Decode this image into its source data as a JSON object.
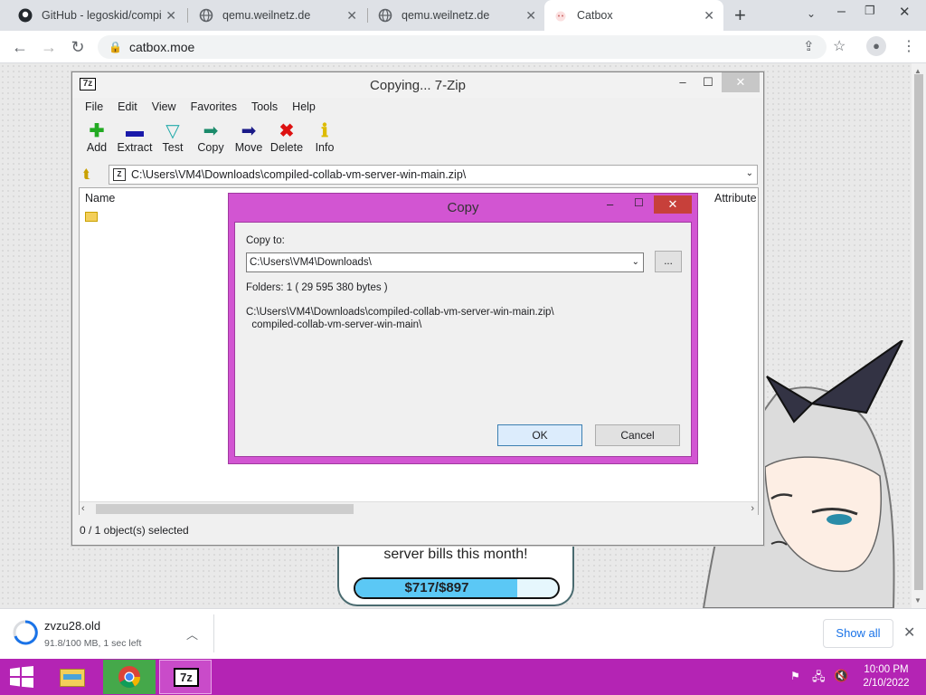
{
  "browser": {
    "tabs": [
      {
        "title": "GitHub - legoskid/compi"
      },
      {
        "title": "qemu.weilnetz.de"
      },
      {
        "title": "qemu.weilnetz.de"
      },
      {
        "title": "Catbox"
      }
    ],
    "url": "catbox.moe"
  },
  "page": {
    "donation_text": "server bills this month!",
    "donation_amount": "$717/$897",
    "donation_progress": 0.8
  },
  "zip": {
    "title": "Copying... 7-Zip",
    "logo": "7z",
    "menu": [
      "File",
      "Edit",
      "View",
      "Favorites",
      "Tools",
      "Help"
    ],
    "tools": [
      {
        "label": "Add",
        "icon": "plus-icon",
        "color": "#22aa22"
      },
      {
        "label": "Extract",
        "icon": "minus-icon",
        "color": "#1a1aaa"
      },
      {
        "label": "Test",
        "icon": "check-icon",
        "color": "#22aaaa"
      },
      {
        "label": "Copy",
        "icon": "arrow-copy-icon",
        "color": "#1a8a6a"
      },
      {
        "label": "Move",
        "icon": "arrow-move-icon",
        "color": "#1a1a88"
      },
      {
        "label": "Delete",
        "icon": "x-icon",
        "color": "#dd1111"
      },
      {
        "label": "Info",
        "icon": "info-icon",
        "color": "#ddbb00"
      }
    ],
    "path": "C:\\Users\\VM4\\Downloads\\compiled-collab-vm-server-win-main.zip\\",
    "col_name": "Name",
    "col_attr": "Attribute",
    "status": "0 / 1 object(s) selected"
  },
  "copy": {
    "title": "Copy",
    "copy_to_label": "Copy to:",
    "dest_value": "C:\\Users\\VM4\\Downloads\\",
    "browse_label": "...",
    "folders": "Folders: 1    ( 29 595 380 bytes )",
    "src_line1": "C:\\Users\\VM4\\Downloads\\compiled-collab-vm-server-win-main.zip\\",
    "src_line2": "  compiled-collab-vm-server-win-main\\",
    "ok": "OK",
    "cancel": "Cancel"
  },
  "download": {
    "filename": "zvzu28.old",
    "progress": "91.8/100 MB, 1 sec left",
    "show_all": "Show all"
  },
  "taskbar": {
    "time": "10:00 PM",
    "date": "2/10/2022",
    "zip_label": "7z"
  }
}
